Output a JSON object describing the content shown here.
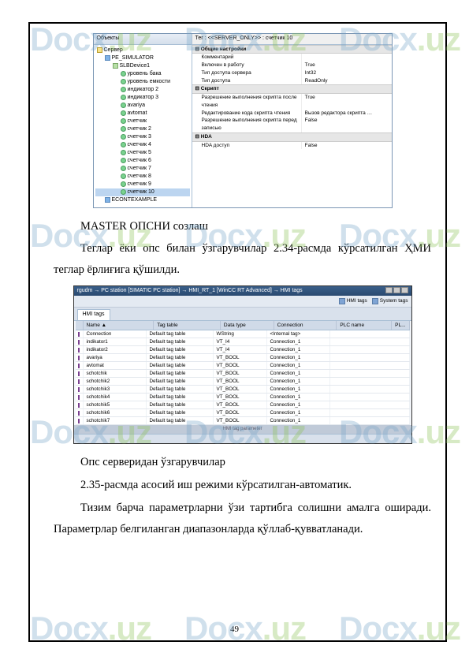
{
  "watermark": "Docx.uz",
  "page_number": "49",
  "screenshot1": {
    "tree_header": "Объекты",
    "right_header": "Тег : <<SERVER_ONLY>> : счетчик 10",
    "tree": [
      {
        "ind": 0,
        "ico": "srv",
        "label": "Сервер"
      },
      {
        "ind": 1,
        "ico": "grp",
        "label": "PE_SIMULATOR"
      },
      {
        "ind": 2,
        "ico": "dev",
        "label": "SLBDevice1"
      },
      {
        "ind": 3,
        "ico": "tag",
        "label": "уровень бака"
      },
      {
        "ind": 3,
        "ico": "tag",
        "label": "уровень емкости"
      },
      {
        "ind": 3,
        "ico": "tag",
        "label": "индикатор 2"
      },
      {
        "ind": 3,
        "ico": "tag",
        "label": "индикатор 3"
      },
      {
        "ind": 3,
        "ico": "tag",
        "label": "avariya"
      },
      {
        "ind": 3,
        "ico": "tag",
        "label": "avtomat"
      },
      {
        "ind": 3,
        "ico": "tag",
        "label": "счетчик"
      },
      {
        "ind": 3,
        "ico": "tag",
        "label": "счетчик 2"
      },
      {
        "ind": 3,
        "ico": "tag",
        "label": "счетчик 3"
      },
      {
        "ind": 3,
        "ico": "tag",
        "label": "счетчик 4"
      },
      {
        "ind": 3,
        "ico": "tag",
        "label": "счетчик 5"
      },
      {
        "ind": 3,
        "ico": "tag",
        "label": "счетчик 6"
      },
      {
        "ind": 3,
        "ico": "tag",
        "label": "счетчик 7"
      },
      {
        "ind": 3,
        "ico": "tag",
        "label": "счетчик 8"
      },
      {
        "ind": 3,
        "ico": "tag",
        "label": "счетчик 9"
      },
      {
        "ind": 3,
        "ico": "tag",
        "label": "счетчик 10",
        "sel": true
      },
      {
        "ind": 1,
        "ico": "grp",
        "label": "ECONTEXAMPLE"
      }
    ],
    "sections": [
      {
        "title": "Общие настройки",
        "rows": [
          {
            "k": "Комментарий",
            "v": ""
          },
          {
            "k": "Включен в работу",
            "v": "True"
          },
          {
            "k": "Тип доступа сервера",
            "v": "Int32"
          },
          {
            "k": "Тип доступа",
            "v": "ReadOnly"
          }
        ]
      },
      {
        "title": "Скрипт",
        "rows": [
          {
            "k": "Разрешение выполнения скрипта после чтения",
            "v": "True"
          },
          {
            "k": "Редактирование кода скрипта чтения",
            "v": "Вызов редактора скрипта …"
          },
          {
            "k": "Разрешение выполнения скрипта перед записью",
            "v": "False"
          }
        ]
      },
      {
        "title": "HDA",
        "rows": [
          {
            "k": "HDA доступ",
            "v": "False"
          }
        ]
      }
    ]
  },
  "text1": {
    "title": "MASTER ОПСНИ созлаш"
  },
  "text2": {
    "para": "Теглар ёки опс билан ўзгарувчилар 2.34-расмда кўрсатилган ҲМИ теглар ёрлиғига қўшилди."
  },
  "screenshot2": {
    "title_bar": "rgudm → PC station [SIMATIC PC station] → HMI_RT_1 [WinCC RT Advanced] → HMI tags",
    "tool1": "HMI tags",
    "tool2": "System tags",
    "tab": "HMI tags",
    "headers": {
      "name": "Name ▲",
      "tagtable": "Tag table",
      "datatype": "Data type",
      "conn": "Connection",
      "plcname": "PLC name",
      "last": "PL..."
    },
    "rows": [
      {
        "n": "Connection",
        "t": "Default tag table",
        "d": "WString",
        "c": "<Internal tag>",
        "p": ""
      },
      {
        "n": "indikator1",
        "t": "Default tag table",
        "d": "VT_I4",
        "c": "Connection_1",
        "p": ""
      },
      {
        "n": "indikator2",
        "t": "Default tag table",
        "d": "VT_I4",
        "c": "Connection_1",
        "p": ""
      },
      {
        "n": "avariya",
        "t": "Default tag table",
        "d": "VT_BOOL",
        "c": "Connection_1",
        "p": ""
      },
      {
        "n": "avtomat",
        "t": "Default tag table",
        "d": "VT_BOOL",
        "c": "Connection_1",
        "p": ""
      },
      {
        "n": "schotchik",
        "t": "Default tag table",
        "d": "VT_BOOL",
        "c": "Connection_1",
        "p": ""
      },
      {
        "n": "schotchik2",
        "t": "Default tag table",
        "d": "VT_BOOL",
        "c": "Connection_1",
        "p": ""
      },
      {
        "n": "schotchik3",
        "t": "Default tag table",
        "d": "VT_BOOL",
        "c": "Connection_1",
        "p": ""
      },
      {
        "n": "schotchik4",
        "t": "Default tag table",
        "d": "VT_BOOL",
        "c": "Connection_1",
        "p": ""
      },
      {
        "n": "schotchik5",
        "t": "Default tag table",
        "d": "VT_BOOL",
        "c": "Connection_1",
        "p": ""
      },
      {
        "n": "schotchik6",
        "t": "Default tag table",
        "d": "VT_BOOL",
        "c": "Connection_1",
        "p": ""
      },
      {
        "n": "schotchik7",
        "t": "Default tag table",
        "d": "VT_BOOL",
        "c": "Connection_1",
        "p": ""
      }
    ],
    "splitter": "HMI tag parameter"
  },
  "text3": {
    "title": "Опс серверидан ўзгарувчилар"
  },
  "text4": {
    "para": "2.35-расмда асосий иш режими кўрсатилган-автоматик."
  },
  "text5": {
    "para": "Тизим барча параметрларни ўзи тартибга солишни амалга оширади. Параметрлар белгиланган диапазонларда қўллаб-қувватланади."
  }
}
